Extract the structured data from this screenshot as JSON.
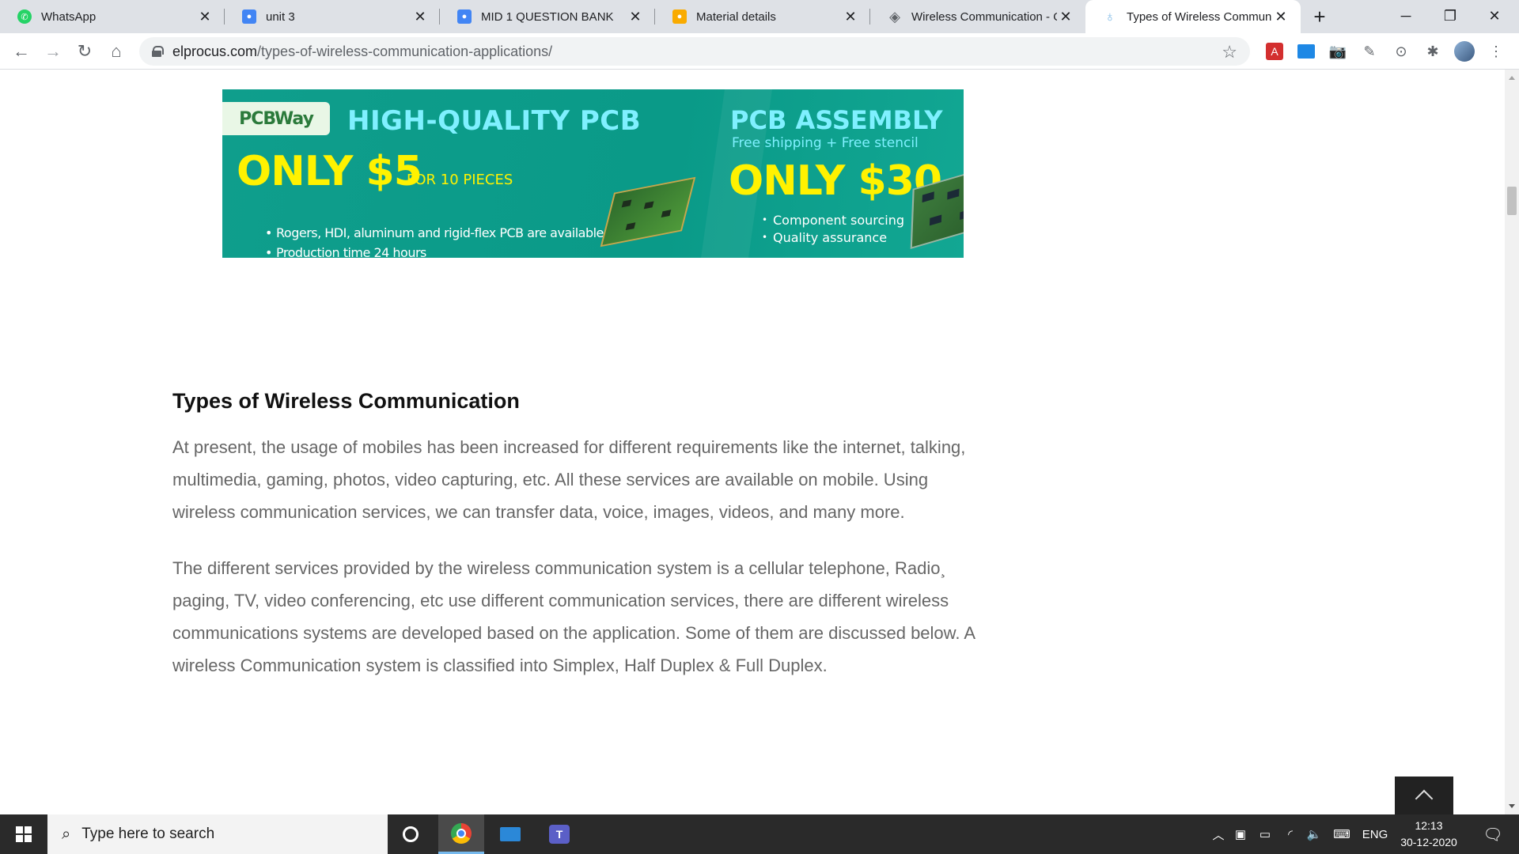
{
  "browser": {
    "tabs": [
      {
        "title": "WhatsApp",
        "icon": "whatsapp-icon",
        "color": "#25d366",
        "active": false
      },
      {
        "title": "unit 3",
        "icon": "classroom-icon",
        "color": "#4285f4",
        "active": false
      },
      {
        "title": "MID 1 QUESTION BANK",
        "icon": "classroom-icon",
        "color": "#4285f4",
        "active": false
      },
      {
        "title": "Material details",
        "icon": "classroom-icon",
        "color": "#f9ab00",
        "active": false
      },
      {
        "title": "Wireless Communication - O",
        "icon": "compass-icon",
        "color": "#5f6368",
        "active": false
      },
      {
        "title": "Types of Wireless Communic",
        "icon": "bulb-icon",
        "color": "#7cb8e6",
        "active": true
      }
    ],
    "new_tab_symbol": "+",
    "url_domain": "elprocus.com",
    "url_path": "/types-of-wireless-communication-applications/"
  },
  "banner": {
    "logo": "PCBWay",
    "left_headline": "HIGH-QUALITY PCB",
    "left_price": "ONLY $5",
    "left_price_note": "FOR 10 PIECES",
    "left_bullets": [
      "Rogers, HDI, aluminum and rigid-flex PCB are available now",
      "Production time 24 hours"
    ],
    "right_headline": "PCB ASSEMBLY",
    "right_subline": "Free shipping + Free stencil",
    "right_price": "ONLY $30",
    "right_bullets": [
      "Component sourcing",
      "Quality assurance"
    ],
    "colors": {
      "background": "#0a9a88",
      "headline": "#7ff0ff",
      "price": "#fff200"
    }
  },
  "article": {
    "heading": "Types of Wireless Communication",
    "paragraph1": [
      "At present, the usage of mobiles has been increased for different requirements like the internet, talking,",
      "multimedia, gaming, photos, video capturing, etc. All these services are available on mobile. Using",
      "wireless communication services, we can transfer data, voice, images, videos, and many more."
    ],
    "paragraph2": [
      "The different services provided by the wireless communication system is a cellular telephone, Radio¸",
      "paging, TV, video conferencing, etc use different communication services, there are different wireless",
      "communications systems are developed based on the application. Some of them are discussed below. A",
      "wireless Communication system is classified into Simplex, Half Duplex & Full Duplex."
    ]
  },
  "taskbar": {
    "search_placeholder": "Type here to search",
    "language": "ENG",
    "time": "12:13",
    "date": "30-12-2020"
  }
}
